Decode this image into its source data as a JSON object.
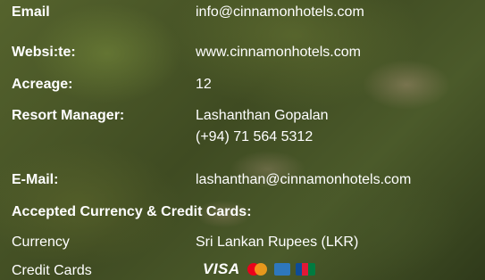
{
  "info": {
    "email_label": "Email",
    "email_value": "info@cinnamonhotels.com",
    "website_label": "Websi:te:",
    "website_value": "www.cinnamonhotels.com",
    "acreage_label": "Acreage:",
    "acreage_value": "12",
    "manager_label": "Resort Manager:",
    "manager_name": "Lashanthan Gopalan",
    "manager_phone": "(+94) 71 564 5312",
    "manager_email_label": "E-Mail:",
    "manager_email_value": "lashanthan@cinnamonhotels.com",
    "payment_heading": "Accepted Currency & Credit Cards:",
    "currency_label": "Currency",
    "currency_value": "Sri Lankan Rupees (LKR)",
    "cards_label": "Credit Cards",
    "visa_text": "VISA"
  },
  "icons": [
    "visa-logo-icon",
    "mastercard-icon",
    "amex-icon",
    "jcb-icon"
  ],
  "colors": {
    "text": "#ffffff",
    "mastercard_red": "#eb001b",
    "mastercard_orange": "#f79e1b",
    "amex_blue": "#2e77bc"
  }
}
